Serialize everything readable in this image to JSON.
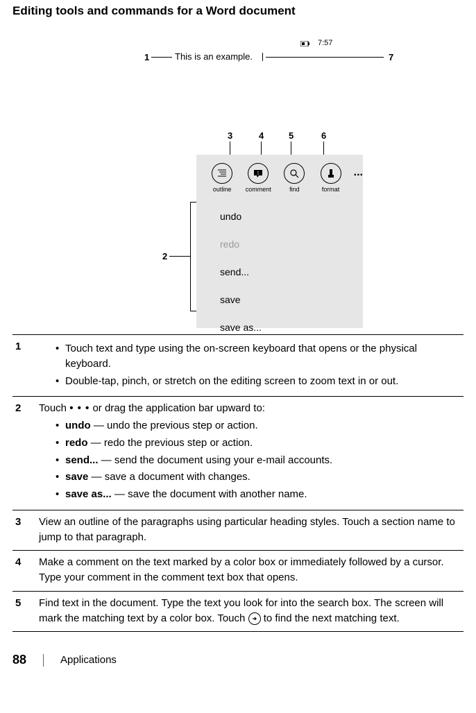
{
  "title": "Editing tools and commands for a Word document",
  "diagram": {
    "caption": "This is an example.",
    "time": "7:57",
    "labels": {
      "l1": "1",
      "l2": "2",
      "l3": "3",
      "l4": "4",
      "l5": "5",
      "l6": "6",
      "l7": "7"
    },
    "tools": {
      "outline": "outline",
      "comment": "comment",
      "find": "find",
      "format": "format"
    },
    "menu": {
      "undo": "undo",
      "redo": "redo",
      "send": "send...",
      "save": "save",
      "saveas": "save as..."
    },
    "more": "..."
  },
  "rows": {
    "r1": {
      "num": "1",
      "b1_a": "Touch text and type using the on-screen keyboard that opens or the physical keyboard.",
      "b1_b": "Double-tap, pinch, or stretch on the editing screen to zoom text in or out."
    },
    "r2": {
      "num": "2",
      "intro_a": "Touch ",
      "intro_b": " or drag the application bar upward to:",
      "undo_l": "undo",
      "undo_t": " — undo the previous step or action.",
      "redo_l": "redo",
      "redo_t": " — redo the previous step or action.",
      "send_l": "send...",
      "send_t": " — send the document using your e-mail accounts.",
      "save_l": "save",
      "save_t": " — save a document with changes.",
      "saveas_l": "save as...",
      "saveas_t": " — save the document with another name."
    },
    "r3": {
      "num": "3",
      "t": "View an outline of the paragraphs using particular heading styles. Touch a section name to jump to that paragraph."
    },
    "r4": {
      "num": "4",
      "t": "Make a comment on the text marked by a color box or immediately followed by a cursor. Type your comment in the comment text box that opens."
    },
    "r5": {
      "num": "5",
      "t_a": "Find text in the document. Type the text you look for into the search box. The screen will mark the matching text by a color box. Touch ",
      "t_b": " to find the next matching text."
    }
  },
  "footer": {
    "page": "88",
    "section": "Applications"
  }
}
